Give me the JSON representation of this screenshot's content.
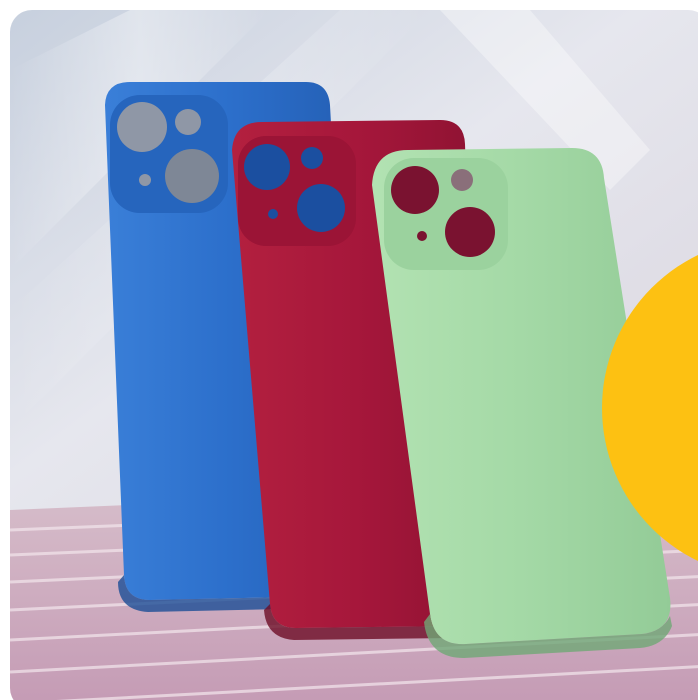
{
  "colors": {
    "accent_circle": "#FDC112",
    "case_blue": "#2C6FCB",
    "case_red": "#A6173B",
    "case_green": "#A4D9A6",
    "backdrop": "#DDE0E8",
    "surface": "#CFA9BF"
  },
  "products": [
    {
      "item": "phone-case",
      "color_name": "blue"
    },
    {
      "item": "phone-case",
      "color_name": "burgundy"
    },
    {
      "item": "phone-case",
      "color_name": "mint-green"
    }
  ]
}
